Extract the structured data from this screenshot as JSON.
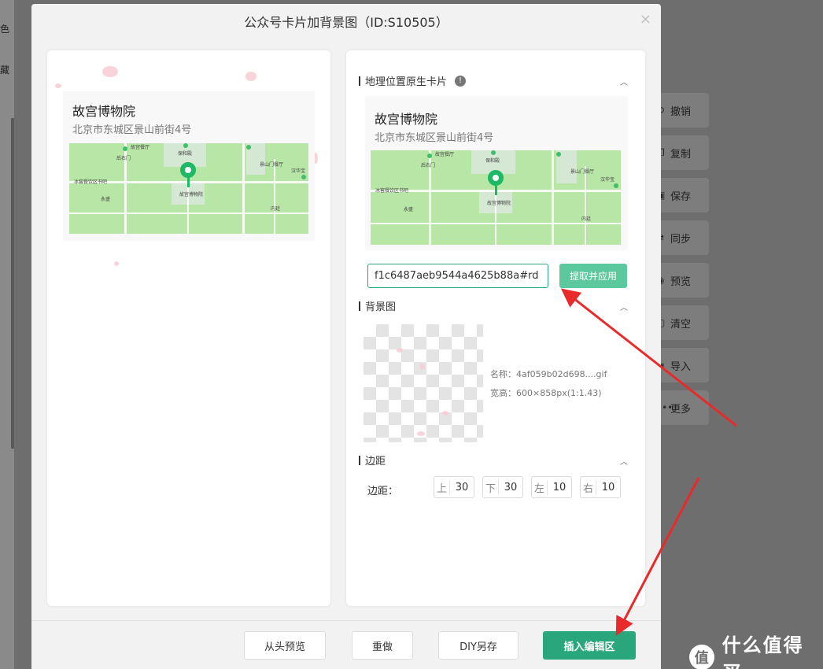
{
  "background": {
    "left_fragments": [
      "色",
      "藏"
    ],
    "toolbar": [
      {
        "label": "撤销",
        "icon": "undo-icon",
        "glyph": "⟲"
      },
      {
        "label": "复制",
        "icon": "copy-icon",
        "glyph": "❐"
      },
      {
        "label": "保存",
        "icon": "save-icon",
        "glyph": "▣"
      },
      {
        "label": "同步",
        "icon": "sync-icon",
        "glyph": "⇄"
      },
      {
        "label": "预览",
        "icon": "eye-icon",
        "glyph": "◉"
      },
      {
        "label": "清空",
        "icon": "clear-icon",
        "glyph": "▢"
      },
      {
        "label": "导入",
        "icon": "import-icon",
        "glyph": "⇥"
      },
      {
        "label": "更多",
        "icon": "more-icon",
        "glyph": "•••"
      }
    ],
    "logo": {
      "mark": "值",
      "text": "什么值得买"
    }
  },
  "modal": {
    "title": "公众号卡片加背景图（ID:S10505）",
    "close_glyph": "×"
  },
  "preview_card": {
    "place_name": "故宫博物院",
    "address": "北京市东城区景山前街4号"
  },
  "map_labels": [
    "故宫餐厅",
    "保和殿",
    "后右门",
    "景山门餐厅",
    "汉华宝",
    "冰窖餐饮区书吧",
    "永盛",
    "故宫博物院",
    "内廷"
  ],
  "location_section": {
    "title": "地理位置原生卡片",
    "info_glyph": "!",
    "card": {
      "place_name": "故宫博物院",
      "address": "北京市东城区景山前街4号"
    },
    "id_input_value": "f1c6487aeb9544a4625b88a#rd",
    "apply_button": "提取并应用"
  },
  "background_section": {
    "title": "背景图",
    "file_name": "名称：4af059b02d698....gif",
    "file_size": "宽高：600×858px(1:1.43)"
  },
  "margin_section": {
    "title": "边距",
    "label": "边距：",
    "fields": [
      {
        "key": "上",
        "value": "30"
      },
      {
        "key": "下",
        "value": "30"
      },
      {
        "key": "左",
        "value": "10"
      },
      {
        "key": "右",
        "value": "10"
      }
    ]
  },
  "footer": {
    "preview_button": "从头预览",
    "redo_button": "重做",
    "diy_button": "DIY另存",
    "insert_button": "插入编辑区"
  },
  "colors": {
    "accent": "#2aa67c",
    "apply": "#5cc89e",
    "arrow": "#e82a2a",
    "map": "#b8e6a6",
    "pin": "#1fb864"
  }
}
